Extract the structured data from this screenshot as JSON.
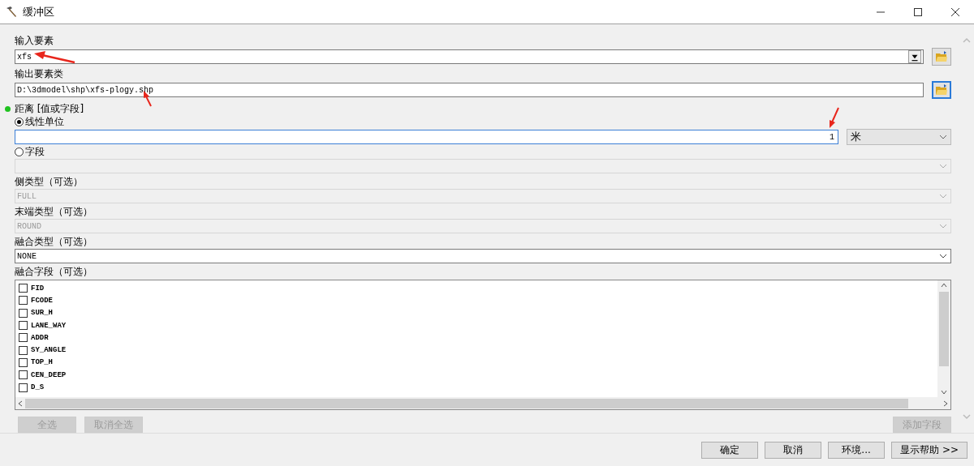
{
  "window": {
    "title": "缓冲区"
  },
  "input_features": {
    "label": "输入要素",
    "value": "xfs"
  },
  "output_class": {
    "label": "输出要素类",
    "value": "D:\\3dmodel\\shp\\xfs-plogy.shp"
  },
  "distance": {
    "label": "距离 [值或字段]",
    "options": [
      {
        "label": "线性单位",
        "selected": true
      },
      {
        "label": "字段",
        "selected": false
      }
    ],
    "value": "1",
    "unit": "米"
  },
  "side_type": {
    "label": "侧类型（可选）",
    "value": "FULL",
    "disabled": true
  },
  "end_type": {
    "label": "末端类型（可选）",
    "value": "ROUND",
    "disabled": true
  },
  "dissolve_type": {
    "label": "融合类型（可选）",
    "value": "NONE",
    "disabled": false
  },
  "dissolve_fields": {
    "label": "融合字段（可选）",
    "items": [
      {
        "label": "FID",
        "checked": false
      },
      {
        "label": "FCODE",
        "checked": false
      },
      {
        "label": "SUR_H",
        "checked": false
      },
      {
        "label": "LANE_WAY",
        "checked": false
      },
      {
        "label": "ADDR",
        "checked": false
      },
      {
        "label": "SY_ANGLE",
        "checked": false
      },
      {
        "label": "TOP_H",
        "checked": false
      },
      {
        "label": "CEN_DEEP",
        "checked": false
      },
      {
        "label": "D_S",
        "checked": false
      }
    ]
  },
  "list_buttons": [
    {
      "label": "全选",
      "disabled": true
    },
    {
      "label": "取消全选",
      "disabled": true
    }
  ],
  "add_field": {
    "label": "添加字段",
    "disabled": true
  },
  "buttons": [
    "确定",
    "取消",
    "环境...",
    "显示帮助 >>"
  ]
}
